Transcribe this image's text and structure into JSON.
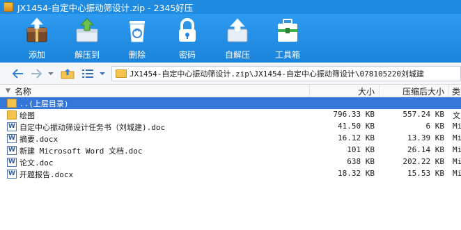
{
  "window": {
    "title": "JX1454-自定中心振动筛设计.zip - 2345好压"
  },
  "toolbar": {
    "buttons": [
      {
        "label": "添加",
        "icon": "add-archive-icon"
      },
      {
        "label": "解压到",
        "icon": "extract-to-icon"
      },
      {
        "label": "删除",
        "icon": "recycle-bin-icon"
      },
      {
        "label": "密码",
        "icon": "padlock-icon"
      },
      {
        "label": "自解压",
        "icon": "self-extract-icon"
      },
      {
        "label": "工具箱",
        "icon": "toolbox-icon"
      }
    ]
  },
  "nav": {
    "back_icon": "back-arrow-icon",
    "forward_icon": "forward-arrow-icon",
    "dropdown_icon": "chevron-down-icon",
    "up_icon": "up-folder-icon",
    "view_icon": "list-view-icon",
    "path": "JX1454-自定中心振动筛设计.zip\\JX1454-自定中心振动筛设计\\078105220刘城建"
  },
  "columns": {
    "name": "名称",
    "size": "大小",
    "compressed": "压缩后大小",
    "type": "类"
  },
  "files": [
    {
      "name": "..(上层目录)",
      "size": "",
      "compressed": "",
      "type": "",
      "kind": "up"
    },
    {
      "name": "绘图",
      "size": "796.33 KB",
      "compressed": "557.24 KB",
      "type": "文",
      "kind": "folder"
    },
    {
      "name": "自定中心振动筛设计任务书（刘城建).doc",
      "size": "41.50 KB",
      "compressed": "6 KB",
      "type": "Mi",
      "kind": "doc"
    },
    {
      "name": "摘要.docx",
      "size": "16.12 KB",
      "compressed": "13.39 KB",
      "type": "Mi",
      "kind": "doc"
    },
    {
      "name": "新建 Microsoft Word 文档.doc",
      "size": "101 KB",
      "compressed": "26.14 KB",
      "type": "Mi",
      "kind": "doc"
    },
    {
      "name": "论文.doc",
      "size": "638 KB",
      "compressed": "202.22 KB",
      "type": "Mi",
      "kind": "doc"
    },
    {
      "name": "开题报告.docx",
      "size": "18.32 KB",
      "compressed": "15.53 KB",
      "type": "Mi",
      "kind": "doc"
    }
  ],
  "selected_index": 0
}
